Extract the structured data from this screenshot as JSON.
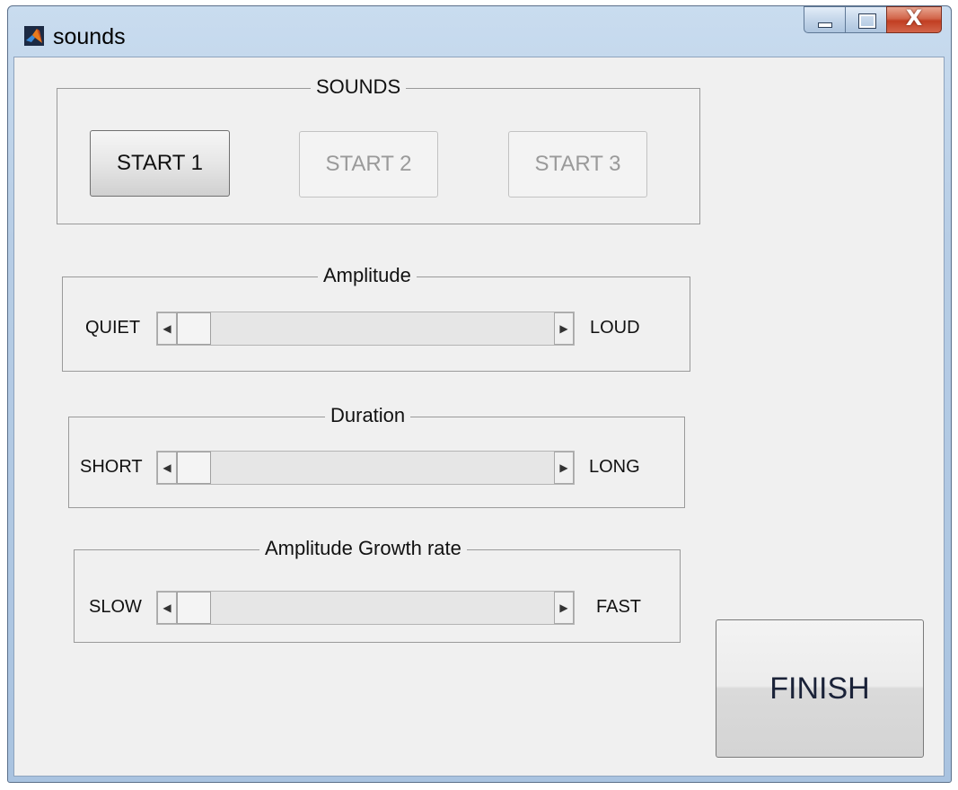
{
  "window": {
    "title": "sounds",
    "icon": "matlab-logo-icon"
  },
  "sounds_panel": {
    "title": "SOUNDS",
    "buttons": [
      {
        "label": "START 1",
        "enabled": true
      },
      {
        "label": "START 2",
        "enabled": false
      },
      {
        "label": "START 3",
        "enabled": false
      }
    ]
  },
  "amplitude_panel": {
    "title": "Amplitude",
    "min_label": "QUIET",
    "max_label": "LOUD",
    "value": 0
  },
  "duration_panel": {
    "title": "Duration",
    "min_label": "SHORT",
    "max_label": "LONG",
    "value": 0
  },
  "growth_panel": {
    "title": "Amplitude Growth rate",
    "min_label": "SLOW",
    "max_label": "FAST",
    "value": 0
  },
  "finish": {
    "label": "FINISH"
  }
}
